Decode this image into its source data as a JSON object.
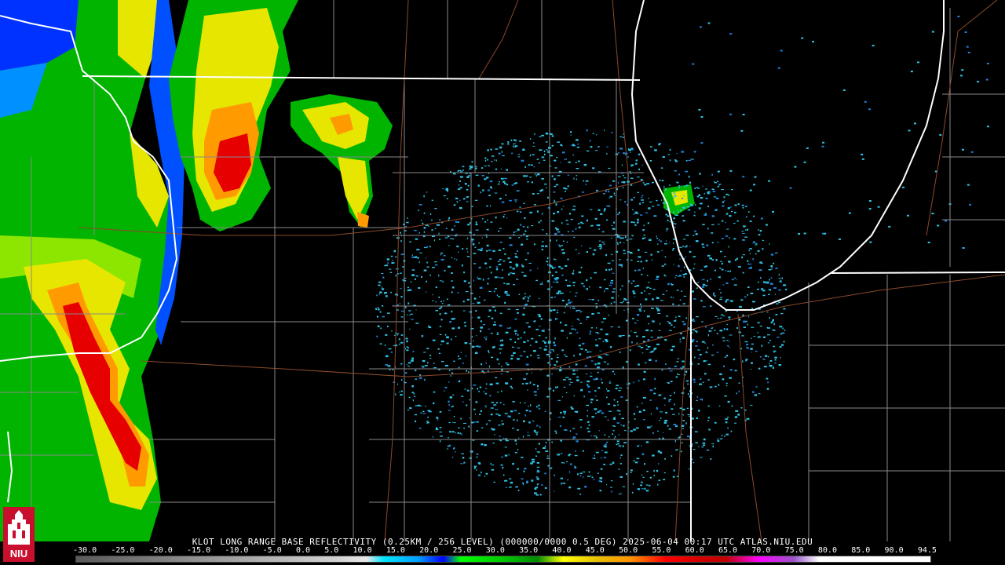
{
  "map": {
    "caption": "KLOT LONG RANGE BASE REFLECTIVITY (0.25KM / 256 LEVEL) (000000/0000 0.5 DEG) 2025-06-04 00:17 UTC  ATLAS.NIU.EDU",
    "scale_labels": [
      "-30.0",
      "-25.0",
      "-20.0",
      "-15.0",
      "-10.0",
      "-5.0",
      "0.0",
      "5.0",
      "10.0",
      "15.0",
      "20.0",
      "25.0",
      "30.0",
      "35.0",
      "40.0",
      "45.0",
      "50.0",
      "55.0",
      "60.0",
      "65.0",
      "70.0",
      "75.0",
      "80.0",
      "85.0",
      "90.0",
      "94.5"
    ],
    "logo_text": "NIU",
    "colors": {
      "background": "#000000",
      "state_line": "#ffffff",
      "county_line": "#8a8a8a",
      "road": "#8b4a2a",
      "clutter": "#2ec4e6"
    }
  }
}
